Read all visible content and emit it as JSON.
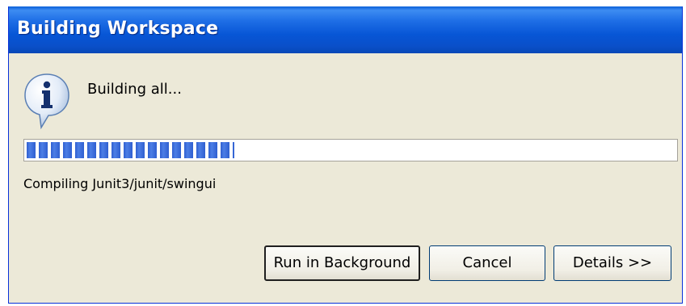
{
  "window": {
    "title": "Building Workspace"
  },
  "dialog": {
    "icon": "info-icon",
    "message": "Building all...",
    "progress_fraction": 0.32,
    "status_text": "Compiling Junit3/junit/swingui"
  },
  "buttons": {
    "run_in_background": "Run in Background",
    "cancel": "Cancel",
    "details": "Details >>"
  },
  "colors": {
    "titlebar": "#0756d6",
    "dialog_background": "#ece9d8",
    "progress_fill": "#2f5fd0"
  }
}
